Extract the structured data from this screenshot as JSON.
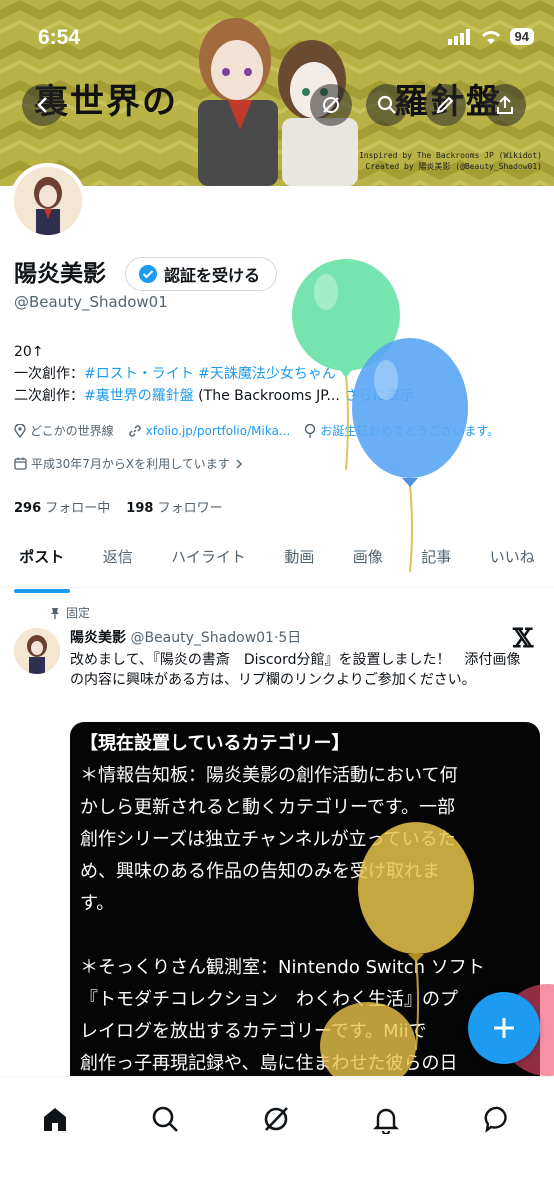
{
  "status_bar": {
    "time": "6:54",
    "battery": "94"
  },
  "banner": {
    "title_left": "裏世界の",
    "title_right": "羅針盤",
    "credit_line1": "Inspired by The Backrooms JP (Wikidot)",
    "credit_line2": "Created by 陽炎美影 (@Beauty_Shadow01)"
  },
  "profile": {
    "name": "陽炎美影",
    "verify_label": "認証を受ける",
    "handle": "@Beauty_Shadow01",
    "bio_line1": "20↑",
    "bio_line2_prefix": "一次創作：",
    "bio_line2_link": "#ロスト・ライト #天誅魔法少女ちゃん",
    "bio_line3_prefix": "二次創作：",
    "bio_line3_link": "#裏世界の羅針盤",
    "bio_line3_rest": " (The Backrooms JP... ",
    "show_more": "さらに表示",
    "location": "どこかの世界線",
    "website": "xfolio.jp/portfolio/Mika...",
    "birthday": "お誕生日おめでとうございます。",
    "joined": "平成30年7月からXを利用しています",
    "following_count": "296",
    "following_label": "フォロー中",
    "followers_count": "198",
    "followers_label": "フォロワー"
  },
  "tabs": [
    "ポスト",
    "返信",
    "ハイライト",
    "動画",
    "画像",
    "記事",
    "いいね"
  ],
  "post": {
    "pinned_label": "固定",
    "author": "陽炎美影",
    "handle_time": "@Beauty_Shadow01·5日",
    "text": "改めまして、『陽炎の書斎　Discord分館』を設置しました！　添付画像の内容に興味がある方は、リプ欄のリンクよりご参加ください。",
    "image_lines": [
      "【現在設置しているカテゴリー】",
      "＊情報告知板：陽炎美影の創作活動において何",
      "かしら更新されると動くカテゴリーです。一部",
      "創作シリーズは独立チャンネルが立っているた",
      "め、興味のある作品の告知のみを受け取れま",
      "す。",
      "",
      "＊そっくりさん観測室：Nintendo Switch ソフト",
      "『トモダチコレクション　わくわく生活』のプ",
      "レイログを放出するカテゴリーです。Miiで",
      "創作っ子再現記録や、島に住まわせた彼らの日"
    ]
  },
  "colors": {
    "accent": "#1d9bf0",
    "banner": "#b9b347"
  },
  "icons": {
    "back": "chevron-left-icon",
    "grok": "grok-icon",
    "search": "search-icon",
    "edit": "pencil-icon",
    "share": "share-icon",
    "x_logo": "x-logo-icon",
    "home": "home-icon",
    "notifications": "bell-icon",
    "messages": "message-icon",
    "compose": "plus-icon"
  }
}
